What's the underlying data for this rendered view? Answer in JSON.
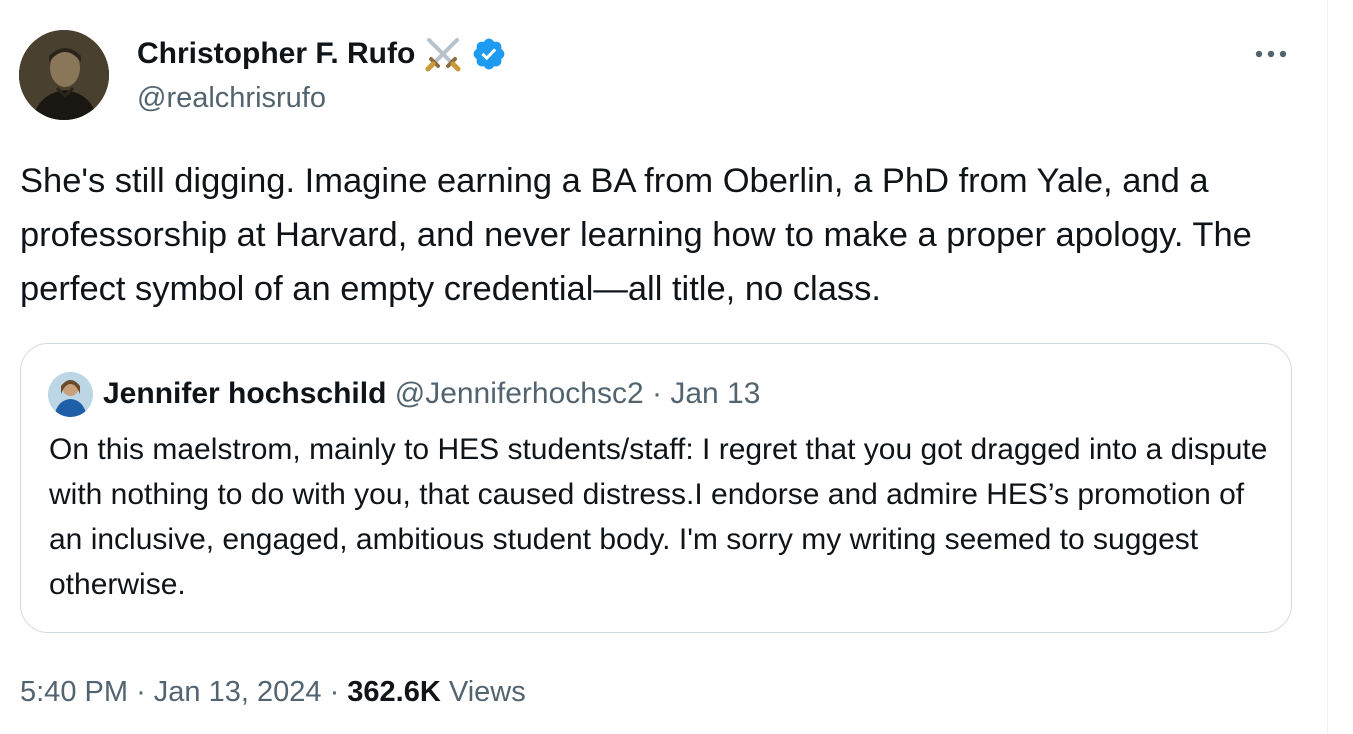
{
  "tweet": {
    "author": {
      "name": "Christopher F. Rufo",
      "handle": "@realchrisrufo",
      "name_emoji_icon": "crossed-swords-icon",
      "verified_icon": "verified-badge-icon"
    },
    "more_icon": "more-options-icon",
    "text": "She's still digging. Imagine earning a BA from Oberlin, a PhD from Yale, and a professorship at Harvard, and never learning how to make a proper apology. The perfect symbol of an empty credential—all title, no class.",
    "quoted": {
      "name": "Jennifer hochschild",
      "handle": "@Jenniferhochsc2",
      "separator": "·",
      "date": "Jan 13",
      "text": "On this maelstrom, mainly to HES students/staff: I regret that you got dragged into a dispute with nothing to do with you, that caused distress.I endorse and admire HES’s promotion of an inclusive, engaged, ambitious student body. I'm sorry my writing seemed to suggest otherwise."
    },
    "meta": {
      "time": "5:40 PM",
      "separator": "·",
      "date": "Jan 13, 2024",
      "views_count": "362.6K",
      "views_label": "Views"
    }
  },
  "colors": {
    "text_primary": "#0f1419",
    "text_secondary": "#536471",
    "verified_blue": "#1d9bf0",
    "quote_border": "#cfd9de"
  }
}
